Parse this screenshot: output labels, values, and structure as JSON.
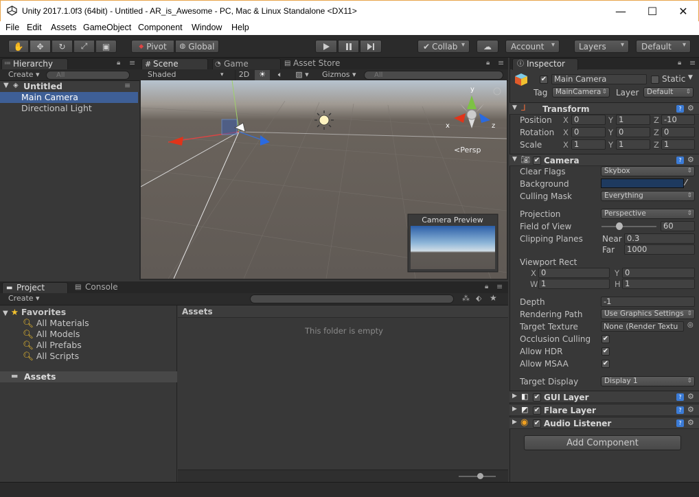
{
  "window": {
    "title": "Unity 2017.1.0f3 (64bit) - Untitled - AR_is_Awesome - PC, Mac & Linux Standalone <DX11>",
    "minimize": "—",
    "maximize": "☐",
    "close": "✕"
  },
  "menu": [
    "File",
    "Edit",
    "Assets",
    "GameObject",
    "Component",
    "Window",
    "Help"
  ],
  "toolbar": {
    "pivot": "Pivot",
    "global": "Global",
    "collab": "Collab",
    "account": "Account",
    "layers": "Layers",
    "layout": "Default"
  },
  "hierarchy": {
    "tab": "Hierarchy",
    "create": "Create",
    "search_placeholder": "All",
    "scene_name": "Untitled",
    "items": [
      "Main Camera",
      "Directional Light"
    ],
    "selected_index": 0
  },
  "scene": {
    "tabs": [
      "Scene",
      "Game",
      "Asset Store"
    ],
    "shading": "Shaded",
    "mode_2d": "2D",
    "gizmos": "Gizmos",
    "search_placeholder": "All",
    "persp_label": "Persp",
    "axis_x": "x",
    "axis_y": "y",
    "axis_z": "z",
    "preview_title": "Camera Preview"
  },
  "project": {
    "tabs": [
      "Project",
      "Console"
    ],
    "create": "Create",
    "favorites_label": "Favorites",
    "favorites": [
      "All Materials",
      "All Models",
      "All Prefabs",
      "All Scripts"
    ],
    "assets_root": "Assets",
    "assets_header": "Assets",
    "empty_message": "This folder is empty"
  },
  "inspector": {
    "tab": "Inspector",
    "object_name": "Main Camera",
    "static_label": "Static",
    "tag_label": "Tag",
    "tag_value": "MainCamera",
    "layer_label": "Layer",
    "layer_value": "Default",
    "transform": {
      "title": "Transform",
      "position_label": "Position",
      "rotation_label": "Rotation",
      "scale_label": "Scale",
      "position": {
        "x": "0",
        "y": "1",
        "z": "-10"
      },
      "rotation": {
        "x": "0",
        "y": "0",
        "z": "0"
      },
      "scale": {
        "x": "1",
        "y": "1",
        "z": "1"
      }
    },
    "camera": {
      "title": "Camera",
      "clear_flags_label": "Clear Flags",
      "clear_flags": "Skybox",
      "background_label": "Background",
      "background_color": "#1e3a5f",
      "culling_mask_label": "Culling Mask",
      "culling_mask": "Everything",
      "projection_label": "Projection",
      "projection": "Perspective",
      "fov_label": "Field of View",
      "fov": "60",
      "fov_fraction": 0.33,
      "clipping_label": "Clipping Planes",
      "near_label": "Near",
      "near": "0.3",
      "far_label": "Far",
      "far": "1000",
      "viewport_label": "Viewport Rect",
      "viewport": {
        "x": "0",
        "y": "0",
        "w": "1",
        "h": "1"
      },
      "depth_label": "Depth",
      "depth": "-1",
      "rendering_path_label": "Rendering Path",
      "rendering_path": "Use Graphics Settings",
      "target_texture_label": "Target Texture",
      "target_texture": "None (Render Textu",
      "occlusion_label": "Occlusion Culling",
      "hdr_label": "Allow HDR",
      "msaa_label": "Allow MSAA",
      "target_display_label": "Target Display",
      "target_display": "Display 1"
    },
    "components": [
      "GUI Layer",
      "Flare Layer",
      "Audio Listener"
    ],
    "add_component": "Add Component"
  }
}
